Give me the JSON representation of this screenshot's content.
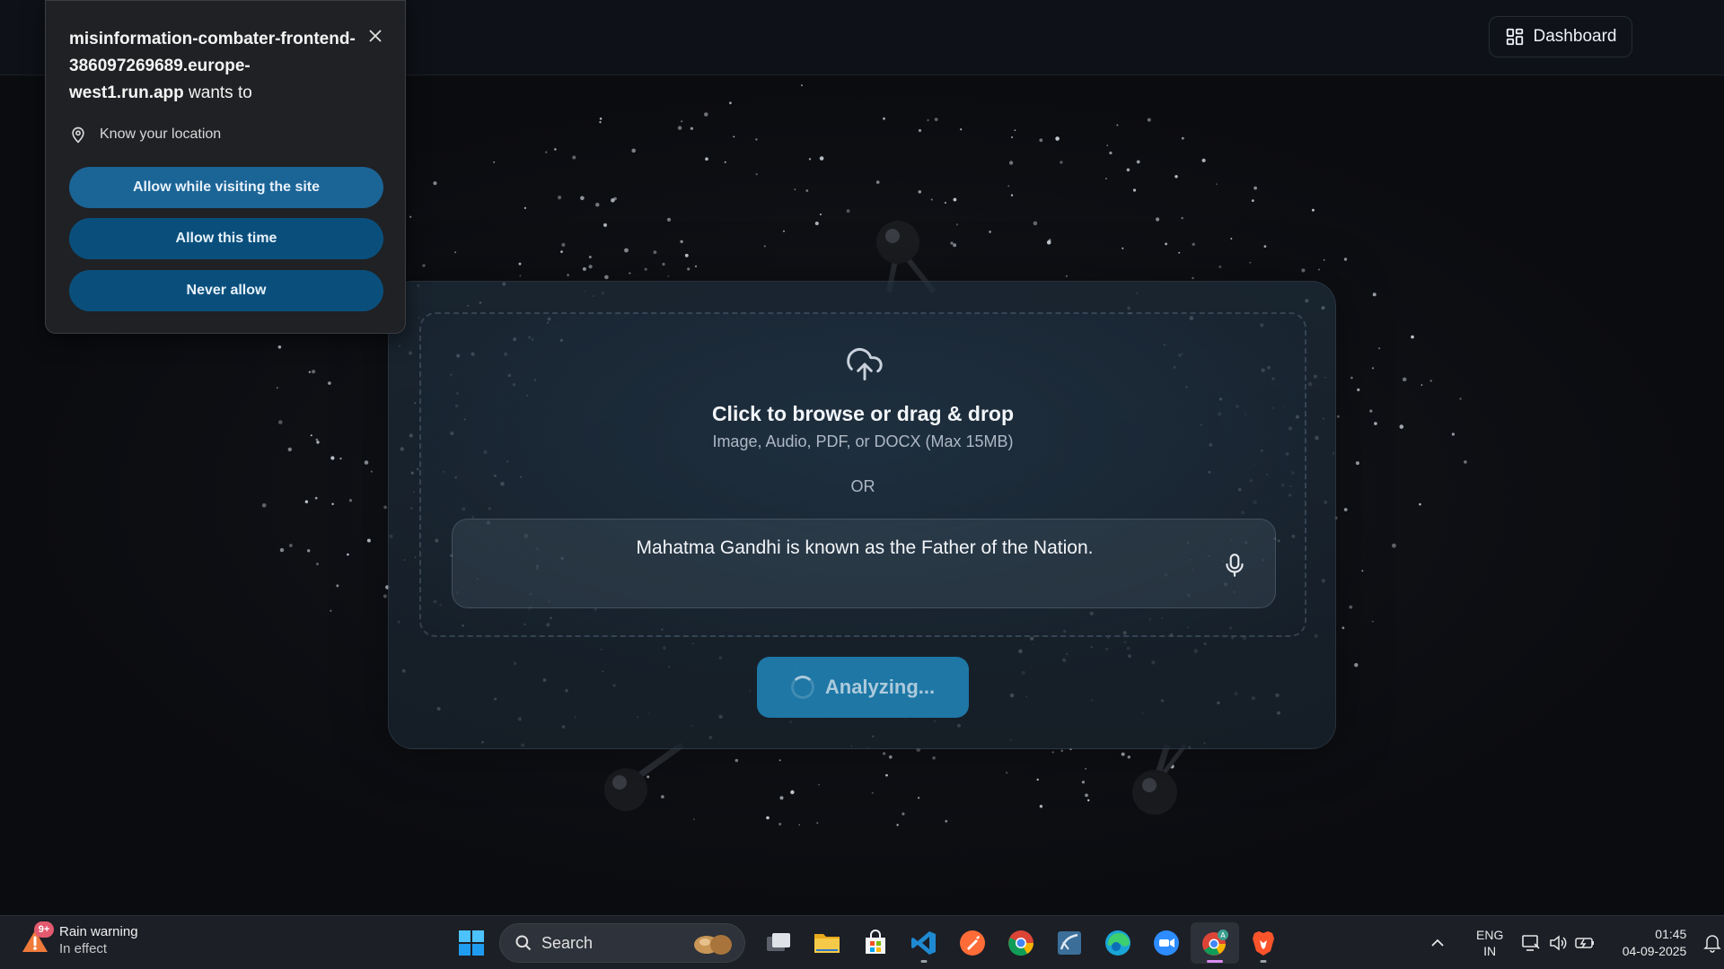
{
  "header": {
    "dashboard_label": "Dashboard"
  },
  "permission_prompt": {
    "origin": "misinformation-combater-frontend-386097269689.europe-west1.run.app",
    "wants_to": "wants to",
    "permission": "Know your location",
    "allow_visiting_label": "Allow while visiting the site",
    "allow_once_label": "Allow this time",
    "never_label": "Never allow"
  },
  "upload": {
    "title": "Click to browse or drag & drop",
    "subtitle": "Image, Audio, PDF, or DOCX (Max 15MB)",
    "separator": "OR"
  },
  "claim_input": {
    "value": "Mahatma Gandhi is known as the Father of the Nation."
  },
  "analyze_button": {
    "label": "Analyzing..."
  },
  "taskbar": {
    "weather": {
      "badge": "9+",
      "title": "Rain warning",
      "subtitle": "In effect"
    },
    "search_label": "Search",
    "apps": [
      "task-view",
      "file-explorer",
      "microsoft-store",
      "vs-code",
      "postman",
      "chrome",
      "mysql-workbench",
      "edge",
      "zoom",
      "chrome-profile",
      "brave"
    ],
    "language_line1": "ENG",
    "language_line2": "IN",
    "time": "01:45",
    "date": "04-09-2025"
  },
  "colors": {
    "accent": "#1f7fb0",
    "popup_primary": "#1b6496",
    "popup_button": "#0a4f7c"
  }
}
